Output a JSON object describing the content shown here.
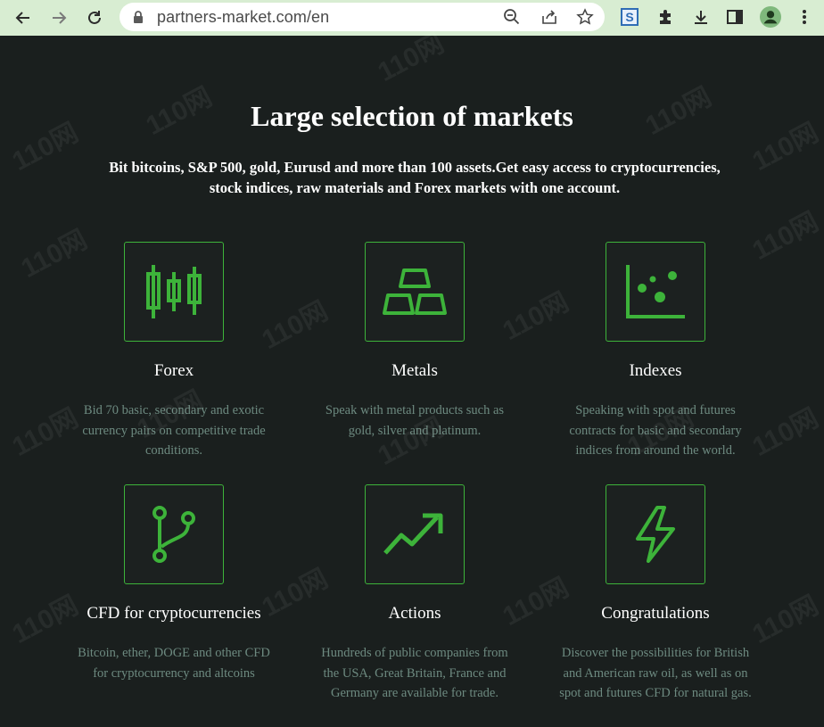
{
  "browser": {
    "url": "partners-market.com/en",
    "icons": [
      "back-arrow-icon",
      "forward-arrow-icon",
      "reload-icon",
      "lock-icon",
      "zoom-icon",
      "share-icon",
      "star-icon",
      "extension-s-icon",
      "puzzle-icon",
      "download-icon",
      "sidepanel-icon",
      "profile-icon",
      "menu-dots-icon"
    ]
  },
  "section": {
    "title": "Large selection of markets",
    "subtitle_line1": "Bit bitcoins, S&P 500, gold, Eurusd and more than 100 assets.Get easy access to cryptocurrencies,",
    "subtitle_line2": "stock indices, raw materials and Forex markets with one account."
  },
  "markets": [
    {
      "name": "Forex",
      "icon": "candlestick-icon",
      "desc": [
        "Bid 70 basic, secondary and exotic",
        "currency pairs on competitive trade",
        "conditions."
      ]
    },
    {
      "name": "Metals",
      "icon": "gold-bars-icon",
      "desc": [
        "Speak with metal products such as",
        "gold, silver and platinum."
      ]
    },
    {
      "name": "Indexes",
      "icon": "scatter-plot-icon",
      "desc": [
        "Speaking with spot and futures",
        "contracts for basic and secondary",
        "indices from around the world."
      ]
    },
    {
      "name": "CFD for cryptocurrencies",
      "icon": "branch-icon",
      "desc": [
        "Bitcoin, ether, DOGE and other CFD",
        "for cryptocurrency and altcoins"
      ]
    },
    {
      "name": "Actions",
      "icon": "trend-up-icon",
      "desc": [
        "Hundreds of public companies from",
        "the USA, Great Britain, France and",
        "Germany are available for trade."
      ]
    },
    {
      "name": "Congratulations",
      "icon": "lightning-icon",
      "desc": [
        "Discover the possibilities for British",
        "and American raw oil, as well as on",
        "spot and futures CFD for natural gas."
      ]
    }
  ],
  "watermark": "110网",
  "colors": {
    "accent": "#3db33a",
    "background": "#1a1f1e",
    "muted_text": "#6d8a80",
    "chrome": "#d8edd2"
  }
}
